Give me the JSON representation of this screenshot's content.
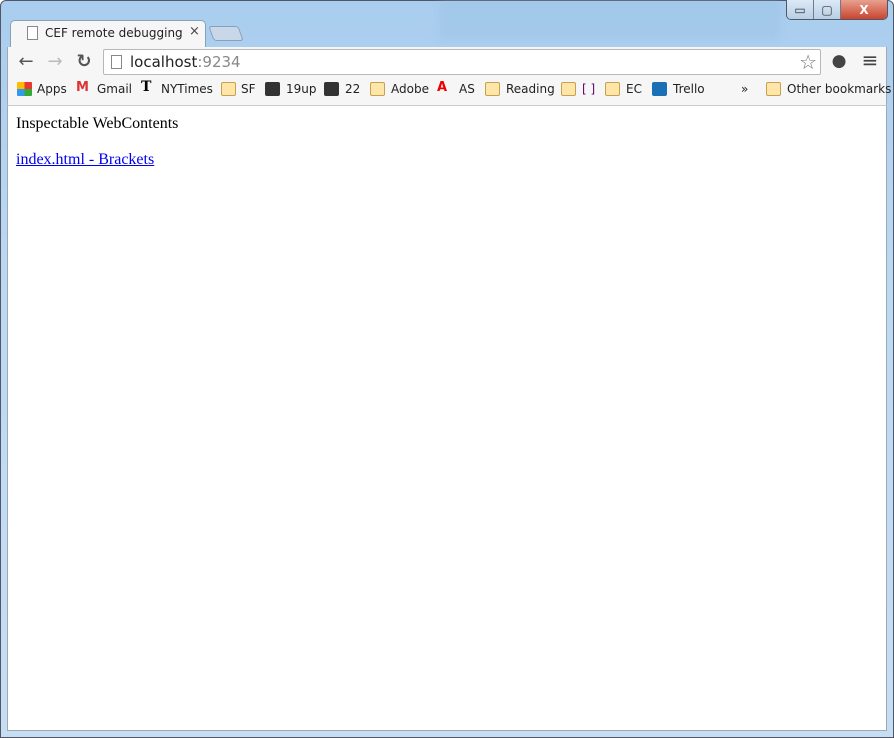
{
  "window": {
    "minimize": "▭",
    "maximize": "▢",
    "close": "X"
  },
  "tab": {
    "title": "CEF remote debugging",
    "close": "×"
  },
  "toolbar": {
    "back": "←",
    "forward": "→",
    "reload": "↻",
    "url_host": "localhost",
    "url_port": ":9234",
    "star": "☆",
    "history": "●",
    "menu": "≡"
  },
  "bookmarks": [
    {
      "label": "Apps",
      "icon": "apps-grid-icon"
    },
    {
      "label": "Gmail",
      "icon": "gmail-icon"
    },
    {
      "label": "NYTimes",
      "icon": "nytimes-icon"
    },
    {
      "label": "SF",
      "icon": "folder-icon"
    },
    {
      "label": "19up",
      "icon": "bus-icon"
    },
    {
      "label": "22",
      "icon": "bus-icon"
    },
    {
      "label": "Adobe",
      "icon": "folder-icon"
    },
    {
      "label": "AS",
      "icon": "adobe-icon"
    },
    {
      "label": "Reading",
      "icon": "folder-icon"
    },
    {
      "label": "[ ]",
      "icon": "folder-icon"
    },
    {
      "label": "EC",
      "icon": "folder-icon"
    },
    {
      "label": "Trello",
      "icon": "trello-icon"
    },
    {
      "label": "Other bookmarks",
      "icon": "folder-icon"
    }
  ],
  "overflow": "»",
  "page": {
    "heading": "Inspectable WebContents",
    "link": "index.html - Brackets"
  },
  "colors": {
    "link": "#0000ee",
    "frame": "#bcd9f3"
  }
}
